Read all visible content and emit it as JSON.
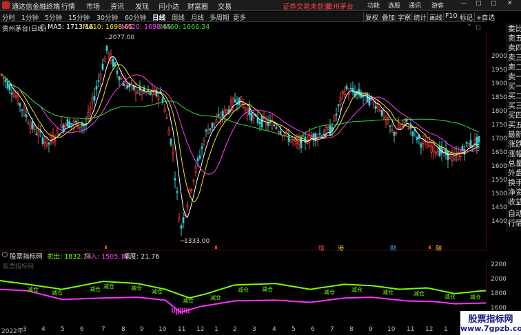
{
  "app": {
    "title": "通达信金融终端"
  },
  "menu": [
    "行情",
    "市场",
    "资讯",
    "发现",
    "问小达",
    "财富圈",
    "交易"
  ],
  "notice": {
    "login": "证券交易未登录",
    "stock_tab": "贵州茅台"
  },
  "top_right": [
    "功能",
    "选股",
    "通讯",
    "游客"
  ],
  "periods": [
    "分时",
    "1分钟",
    "5分钟",
    "15分钟",
    "30分钟",
    "60分钟",
    "日线",
    "周线",
    "月线",
    "多周期",
    "更多"
  ],
  "active_period": "日线",
  "toolbar": [
    "复权",
    "叠加",
    "字察",
    "统计",
    "画线",
    "F10",
    "标记",
    "+自选"
  ],
  "stock": {
    "name_period": "贵州茅台(日线)"
  },
  "ma": [
    {
      "label": "MA5: 1713.16",
      "color": "#ffffff"
    },
    {
      "label": "MA10: 1698.65",
      "color": "#ffe020"
    },
    {
      "label": "MA20: 1698.45",
      "color": "#ff40ff"
    },
    {
      "label": "MA60: 1666.34",
      "color": "#30e030"
    }
  ],
  "annotations": {
    "high": "2077.00",
    "low": "1333.00"
  },
  "price_axis": [
    "2000",
    "1950",
    "1900",
    "1850",
    "1800",
    "1750",
    "1700",
    "1650",
    "1600",
    "1550",
    "1500",
    "1450",
    "1400"
  ],
  "side_panel": [
    "委比",
    "卖五",
    "卖四",
    "卖三",
    "卖二",
    "卖一",
    "买一",
    "买二",
    "买三",
    "买四",
    "买五",
    "最新",
    "涨跌",
    "涨幅",
    "总量",
    "外盘",
    "换手",
    "净资",
    "收益",
    "自动",
    "行情"
  ],
  "event_markers": [
    "增",
    "港",
    "财",
    "融"
  ],
  "indicator": {
    "name": "股票指标网",
    "sell": "卖出: 1832.74",
    "buy": "买入: 1505.17",
    "amp": "幅度: 21.76",
    "axis": [
      "2200",
      "2000",
      "1800",
      "1600"
    ],
    "reduce_label": "减仓"
  },
  "date_axis": [
    "2022年",
    "3",
    "4",
    "5",
    "6",
    "7",
    "8",
    "9",
    "10",
    "11",
    "12",
    "1",
    "2",
    "3",
    "4",
    "5",
    "6",
    "7",
    "8",
    "9",
    "10",
    "11",
    "12",
    "1"
  ],
  "watermark": {
    "line1": "股票指标网",
    "line2": "www.7gpzb.com"
  },
  "colors": {
    "up": "#ff3b3b",
    "down": "#30d0d0",
    "ma5": "#ffffff",
    "ma10": "#ffe020",
    "ma20": "#ff40ff",
    "ma60": "#30e030",
    "sell_line": "#7cfc00",
    "buy_line": "#ff33ff"
  }
}
